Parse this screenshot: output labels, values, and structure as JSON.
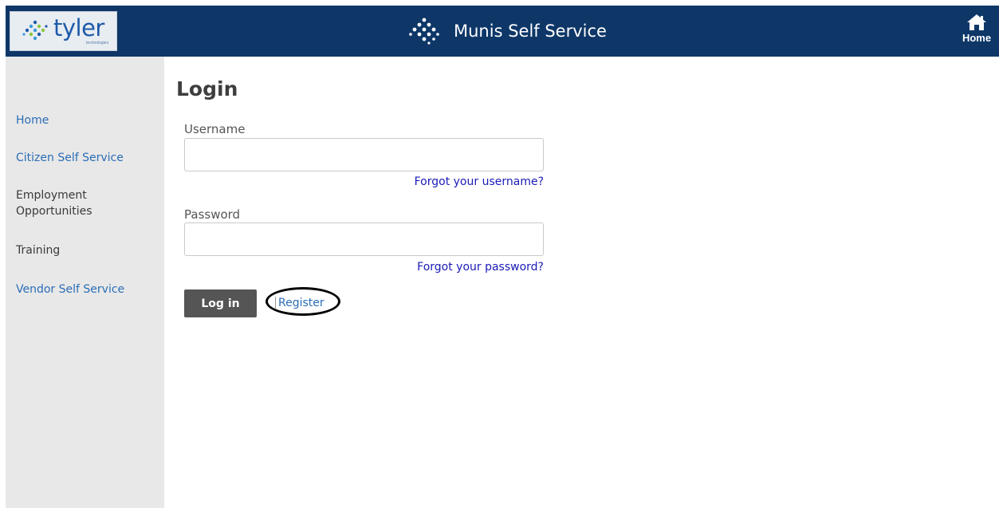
{
  "header": {
    "logo_text": "tyler",
    "logo_subtext": "technologies",
    "app_title": "Munis Self Service",
    "home_label": "Home",
    "colors": {
      "bar": "#0e3768",
      "logo_blue": "#1e5aa8"
    }
  },
  "sidebar": {
    "items": [
      {
        "label": "Home",
        "style": "link"
      },
      {
        "label": "Citizen Self Service",
        "style": "link"
      },
      {
        "label_line1": "Employment",
        "label_line2": "Opportunities",
        "style": "plain"
      },
      {
        "label": "Training",
        "style": "plain"
      },
      {
        "label": "Vendor Self Service",
        "style": "link"
      }
    ]
  },
  "login": {
    "title": "Login",
    "username_label": "Username",
    "username_value": "",
    "forgot_username": "Forgot your username?",
    "password_label": "Password",
    "password_value": "",
    "forgot_password": "Forgot your password?",
    "login_button": "Log in",
    "register_link": "Register"
  },
  "icons": {
    "logo": "tyler-dots-logo-icon",
    "app": "munis-dots-icon",
    "home": "house-icon"
  }
}
